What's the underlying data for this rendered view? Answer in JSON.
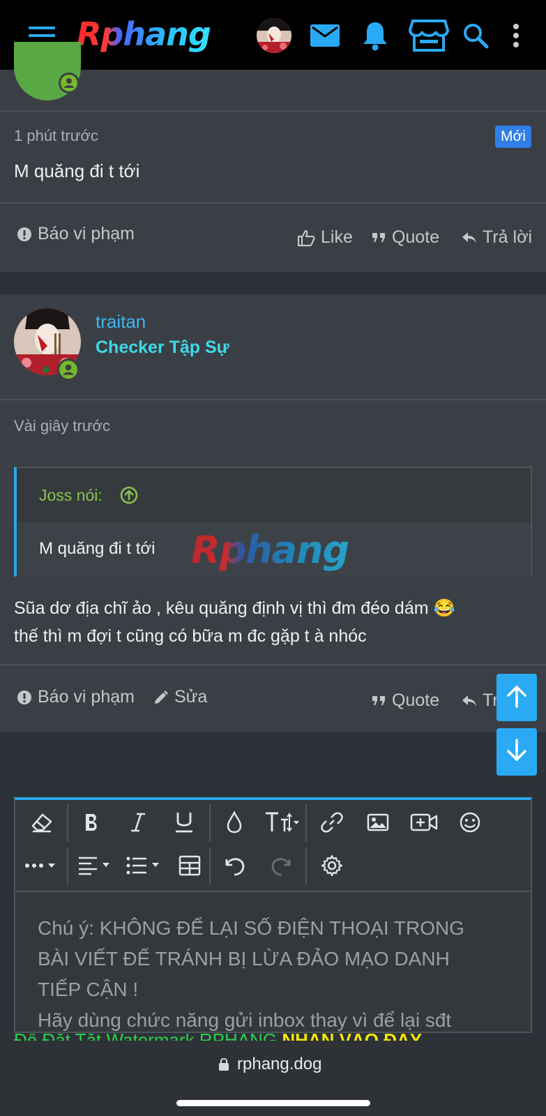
{
  "header": {
    "logo_text": "Rphang",
    "icons": [
      "menu-icon",
      "avatar",
      "mail-icon",
      "bell-icon",
      "store-icon",
      "search-icon",
      "more-vertical-icon"
    ]
  },
  "post1": {
    "time": "1 phút trước",
    "badge": "Mới",
    "body": "M quăng đi t tới",
    "report": "Báo vi phạm",
    "like": "Like",
    "quote": "Quote",
    "reply": "Trả lời"
  },
  "post2": {
    "username": "traitan",
    "rank": "Checker Tập Sự",
    "time": "Vài giây trước",
    "quote_author": "Joss nói:",
    "quote_text": "M quăng đi t tới",
    "watermark": "Rphang",
    "body_line1": "Sũa dơ địa chĩ ảo , kêu quăng định vị thì đm đéo dám 😂",
    "body_line2": "thế thì m đợi t cũng có bữa m đc gặp t à nhóc",
    "report": "Báo vi phạm",
    "edit": "Sửa",
    "quote": "Quote",
    "reply": "Tr"
  },
  "editor": {
    "placeholder_lines": [
      "Chú ý: KHÔNG ĐỂ LẠI SỐ ĐIỆN THOẠI TRONG",
      "BÀI VIẾT ĐỂ TRÁNH BỊ LỪA ĐẢO MẠO DANH",
      "TIẾP CẬN !",
      "Hãy dùng chức năng gửi inbox thay vì để lại sđt"
    ],
    "promo_green": "Để Đặt Tắt Watermark RPHANG",
    "promo_yellow": "NHẤN VÀO ĐÂY"
  },
  "browser": {
    "url": "rphang.dog"
  },
  "colors": {
    "accent_blue": "#28a8ee",
    "username_blue": "#3fb6f0",
    "rank_cyan": "#3fd9e8",
    "quote_green": "#8bc34a",
    "online_green": "#76b82a"
  }
}
